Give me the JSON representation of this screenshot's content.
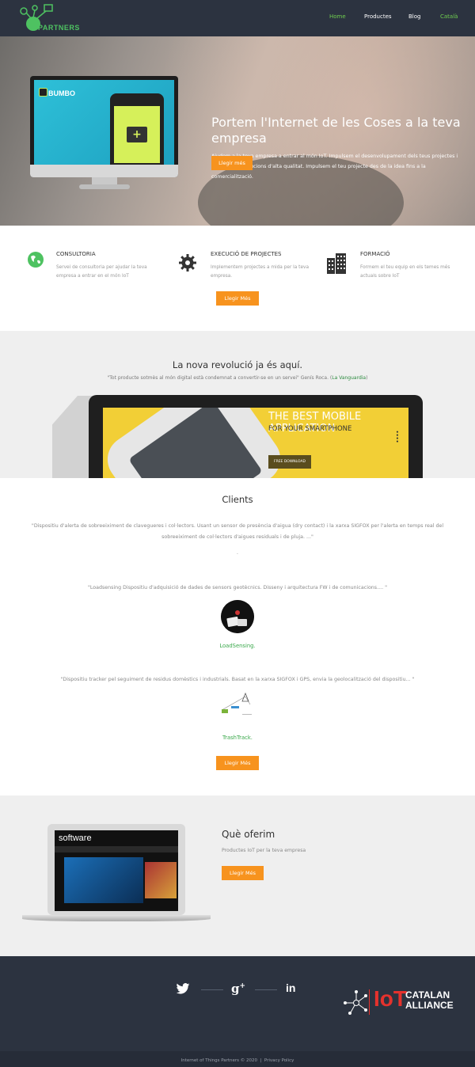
{
  "nav": {
    "logo_text": "PARTNERS",
    "logo_mark": "IoT",
    "items": [
      "Home",
      "Productes",
      "Blog"
    ],
    "language": "Català"
  },
  "hero": {
    "title": "Portem l'Internet de les Coses a la teva empresa",
    "text": "Ajudem a la teva empresa a entrar al món IoT. Impulsem el desenvolupament dels teus projectes i aconseguim solucions d'alta qualitat. Impulsem el teu projecte des de la idea fins a la comercialització.",
    "button": "Llegir més",
    "mock_app_name": "BUMBO"
  },
  "services": [
    {
      "icon": "globe-icon",
      "title": "CONSULTORIA",
      "desc": "Servei de consultoria per ajudar la teva empresa a entrar en el món IoT"
    },
    {
      "icon": "gear-icon",
      "title": "EXECUCIÓ DE PROJECTES",
      "desc": "Implementem projectes a mida per la teva empresa."
    },
    {
      "icon": "building-icon",
      "title": "FORMACIÓ",
      "desc": "Formem el teu equip en els temes més actuals sobre IoT"
    }
  ],
  "services_button": "Llegir Més",
  "revolution": {
    "title": "La nova revolució ja és aquí.",
    "quote": "\"Tot producte sotmès al món digital està condemnat a convertir-se en un servei\" Genís Roca. (",
    "quote_link": "La Vanguardia",
    "quote_end": ")",
    "mock_line1": "THE BEST MOBILE APPLICATION",
    "mock_line2": "FOR YOUR SMARTPHONE",
    "mock_button": "FREE DOWNLOAD"
  },
  "clients": {
    "title": "Clients",
    "items": [
      {
        "text": "\"Dispositiu d'alerta de sobreeiximent de clavegueres i col·lectors. Usant un sensor de presència d'aigua (dry contact) i la xarxa SIGFOX per l'alerta en temps real del sobreeiximent de col·lectors d'aigues residuals i de pluja. ...\"",
        "name": "."
      },
      {
        "text": "\"Loadsensing Dispositiu d'adquisició de dades de sensors geotècnics. Disseny i arquitectura FW i de comunicacions.... \"",
        "name": "LoadSensing."
      },
      {
        "text": "\"Dispositiu tracker pel seguiment de residus domèstics i industrials. Basat en la xarxa SIGFOX i GPS, envia la geolocalització del dispositiu... \"",
        "name": "TrashTrack."
      }
    ],
    "button": "Llegir Més"
  },
  "offer": {
    "title": "Què oferim",
    "text": "Productes IoT per la teva empresa",
    "button": "Llegir Més",
    "mock_label": "software"
  },
  "footer": {
    "social": [
      "twitter-icon",
      "google-plus-icon",
      "linkedin-icon"
    ],
    "alliance_iot": "IoT",
    "alliance_text": "CATALAN ALLIANCE",
    "copyright": "Internet of Things Partners © 2020",
    "privacy": "Privacy Policy"
  },
  "colors": {
    "nav_bg": "#2c3340",
    "accent_green": "#6fce4f",
    "button_orange": "#f7931e"
  }
}
